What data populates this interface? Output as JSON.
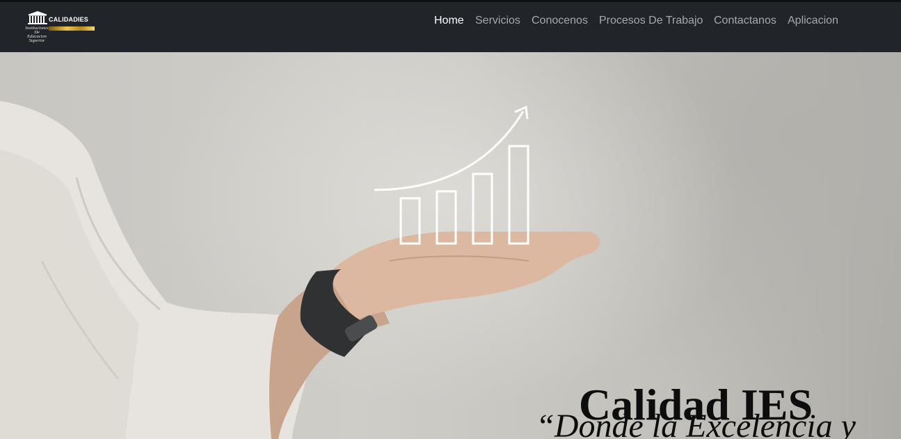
{
  "logo": {
    "name": "CALIDADIES",
    "subtitle_lines": [
      "Instituciones",
      "De Educacion",
      "Superior"
    ]
  },
  "nav": {
    "items": [
      {
        "label": "Home",
        "active": true
      },
      {
        "label": "Servicios",
        "active": false
      },
      {
        "label": "Conocenos",
        "active": false
      },
      {
        "label": "Procesos De Trabajo",
        "active": false
      },
      {
        "label": "Contactanos",
        "active": false
      },
      {
        "label": "Aplicacion",
        "active": false
      }
    ]
  },
  "hero": {
    "title": "Calidad IES",
    "tagline": "“Donde la Excelencia y"
  },
  "colors": {
    "navbar": "#212529",
    "nav_active": "#ffffff",
    "nav_inactive": "#a6a9ac",
    "logo_gold": "#e9c44f",
    "hero_text": "#0d0d0d"
  },
  "icons": [
    "building-icon",
    "growth-chart-icon"
  ]
}
